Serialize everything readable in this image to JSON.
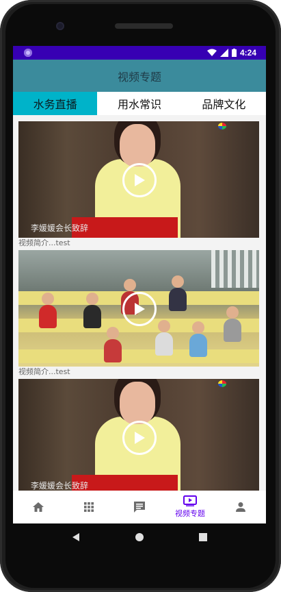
{
  "status_bar": {
    "time": "4:24",
    "colors": {
      "background": "#3700b3"
    }
  },
  "app_bar": {
    "title": "视频专题",
    "color": "#3b8b9c"
  },
  "tabs": [
    {
      "label": "水务直播",
      "active": true
    },
    {
      "label": "用水常识",
      "active": false
    },
    {
      "label": "品牌文化",
      "active": false
    }
  ],
  "videos": [
    {
      "overlay_caption": "李媛媛会长致辞",
      "description": "视频简介...test",
      "scene": "speech"
    },
    {
      "overlay_caption": "",
      "description": "视频简介...test",
      "scene": "classroom"
    },
    {
      "overlay_caption": "李媛媛会长致辞",
      "description": "",
      "scene": "speech"
    }
  ],
  "bottom_nav": {
    "items": [
      {
        "icon": "home-icon",
        "label": ""
      },
      {
        "icon": "grid-icon",
        "label": ""
      },
      {
        "icon": "message-icon",
        "label": ""
      },
      {
        "icon": "video-icon",
        "label": "视频专题",
        "active": true
      },
      {
        "icon": "person-icon",
        "label": ""
      }
    ],
    "active_color": "#6200ee"
  },
  "system_nav": {
    "icons": [
      "back-icon",
      "home-circle-icon",
      "recents-icon"
    ]
  }
}
